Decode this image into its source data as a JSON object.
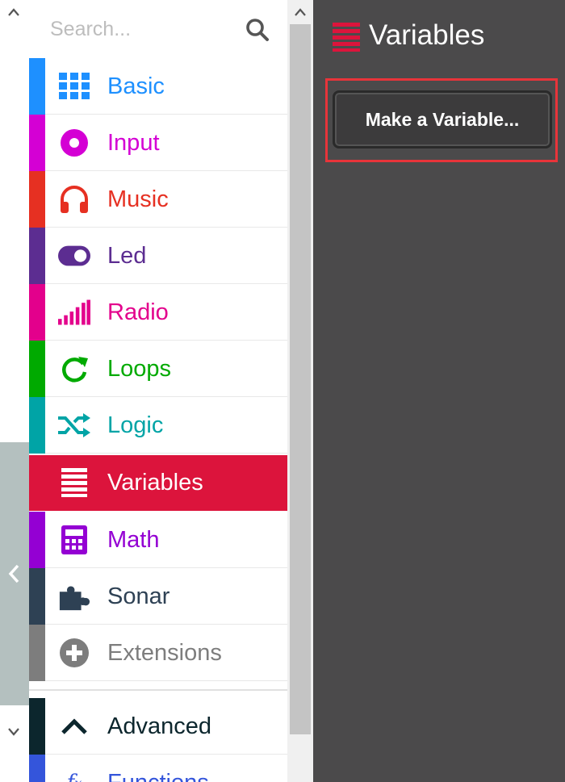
{
  "search": {
    "placeholder": "Search..."
  },
  "categories": [
    {
      "label": "Basic",
      "color": "#1e90ff",
      "icon": "grid-icon"
    },
    {
      "label": "Input",
      "color": "#d400d4",
      "icon": "target-icon"
    },
    {
      "label": "Music",
      "color": "#e63022",
      "icon": "headphones-icon"
    },
    {
      "label": "Led",
      "color": "#5c2d91",
      "icon": "toggle-icon"
    },
    {
      "label": "Radio",
      "color": "#e3008c",
      "icon": "signal-bars-icon"
    },
    {
      "label": "Loops",
      "color": "#00aa00",
      "icon": "refresh-icon"
    },
    {
      "label": "Logic",
      "color": "#00a4a6",
      "icon": "shuffle-icon"
    },
    {
      "label": "Variables",
      "color": "#dc143c",
      "icon": "list-icon",
      "selected": true
    },
    {
      "label": "Math",
      "color": "#9400d3",
      "icon": "calculator-icon"
    },
    {
      "label": "Sonar",
      "color": "#2e4154",
      "icon": "puzzle-icon"
    },
    {
      "label": "Extensions",
      "color": "#7d7d7d",
      "icon": "plus-circle-icon"
    }
  ],
  "advanced": [
    {
      "label": "Advanced",
      "color": "#0c262d",
      "icon": "chevron-up-icon"
    },
    {
      "label": "Functions",
      "color": "#3455db",
      "icon": "function-icon"
    }
  ],
  "flyout": {
    "title": "Variables",
    "make_variable_label": "Make a Variable..."
  }
}
